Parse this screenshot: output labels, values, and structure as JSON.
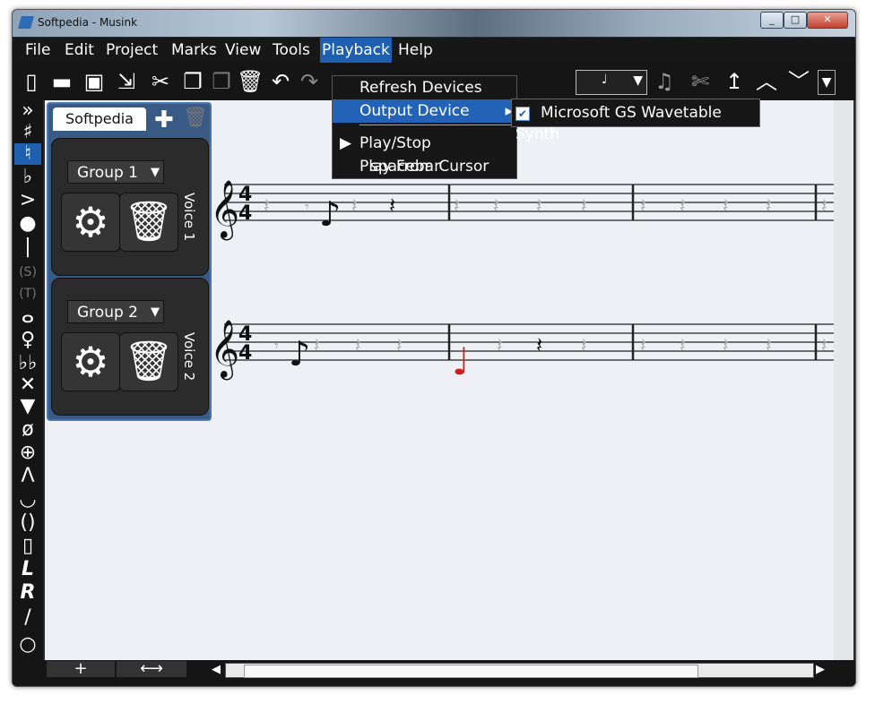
{
  "window": {
    "title": "Softpedia - Musink"
  },
  "menubar": [
    "File",
    "Edit",
    "Project",
    "Marks",
    "View",
    "Tools",
    "Playback",
    "Help"
  ],
  "playback_menu": {
    "items": [
      "Refresh Devices",
      "Output Device",
      "Play/Stop",
      "Play From Cursor"
    ],
    "shortcut_play_stop": "spacebar"
  },
  "output_device_submenu": {
    "item": "Microsoft GS Wavetable Synth",
    "checked": true
  },
  "panel": {
    "tab": "Softpedia",
    "groups": [
      {
        "name": "Group 1",
        "voice": "Voice 1"
      },
      {
        "name": "Group 2",
        "voice": "Voice 2"
      }
    ]
  },
  "toolbar_icons": [
    "new-file-icon",
    "open-folder-icon",
    "save-icon",
    "export-icon",
    "cut-icon",
    "copy-icon",
    "paste-icon",
    "delete-icon",
    "undo-icon",
    "redo-icon"
  ],
  "palette_icons": [
    "double-chevron-icon",
    "sharp-icon",
    "natural-icon",
    "flat-icon",
    "accent-icon",
    "whole-note-icon",
    "stem-icon",
    "s-icon",
    "t-icon",
    "fermata-icon",
    "dagger-icon",
    "double-flat-icon",
    "x-icon",
    "triangle-icon",
    "null-icon",
    "stop-icon",
    "caret-icon",
    "breath-icon",
    "bracket-icon",
    "box-icon",
    "L-icon",
    "R-icon",
    "slash-icon",
    "circle-icon"
  ],
  "colors": {
    "accent": "#1f5fb0",
    "highlight_note": "#cc1f1f"
  }
}
